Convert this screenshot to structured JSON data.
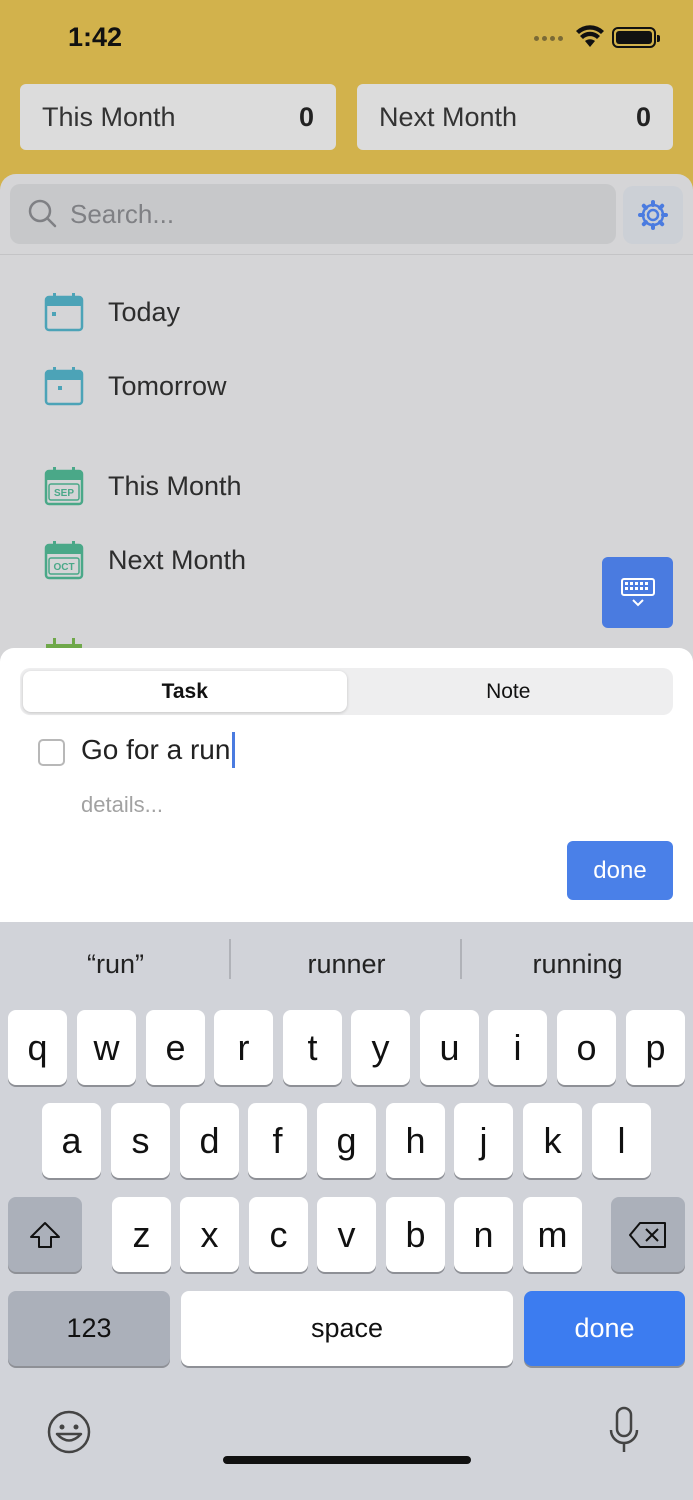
{
  "status": {
    "time": "1:42"
  },
  "counters": [
    {
      "label": "This Month",
      "count": "0"
    },
    {
      "label": "Next Month",
      "count": "0"
    }
  ],
  "search": {
    "placeholder": "Search..."
  },
  "list": {
    "items": [
      {
        "label": "Today",
        "icon": "calendar-today-icon"
      },
      {
        "label": "Tomorrow",
        "icon": "calendar-tomorrow-icon"
      },
      {
        "label": "This Month",
        "icon": "calendar-month-icon",
        "badge": "SEP"
      },
      {
        "label": "Next Month",
        "icon": "calendar-month-icon",
        "badge": "OCT"
      }
    ]
  },
  "composer": {
    "tabs": [
      {
        "label": "Task",
        "active": true
      },
      {
        "label": "Note",
        "active": false
      }
    ],
    "task_value": "Go for a run",
    "details_placeholder": "details...",
    "done_label": "done"
  },
  "keyboard": {
    "suggestions": [
      "“run”",
      "runner",
      "running"
    ],
    "rows": [
      [
        "q",
        "w",
        "e",
        "r",
        "t",
        "y",
        "u",
        "i",
        "o",
        "p"
      ],
      [
        "a",
        "s",
        "d",
        "f",
        "g",
        "h",
        "j",
        "k",
        "l"
      ],
      [
        "z",
        "x",
        "c",
        "v",
        "b",
        "n",
        "m"
      ]
    ],
    "numbers_label": "123",
    "space_label": "space",
    "return_label": "done"
  },
  "colors": {
    "header": "#d2b24c",
    "accent": "#4a7be0",
    "calendar_teal": "#4ca3b7",
    "calendar_green": "#4aa888"
  }
}
